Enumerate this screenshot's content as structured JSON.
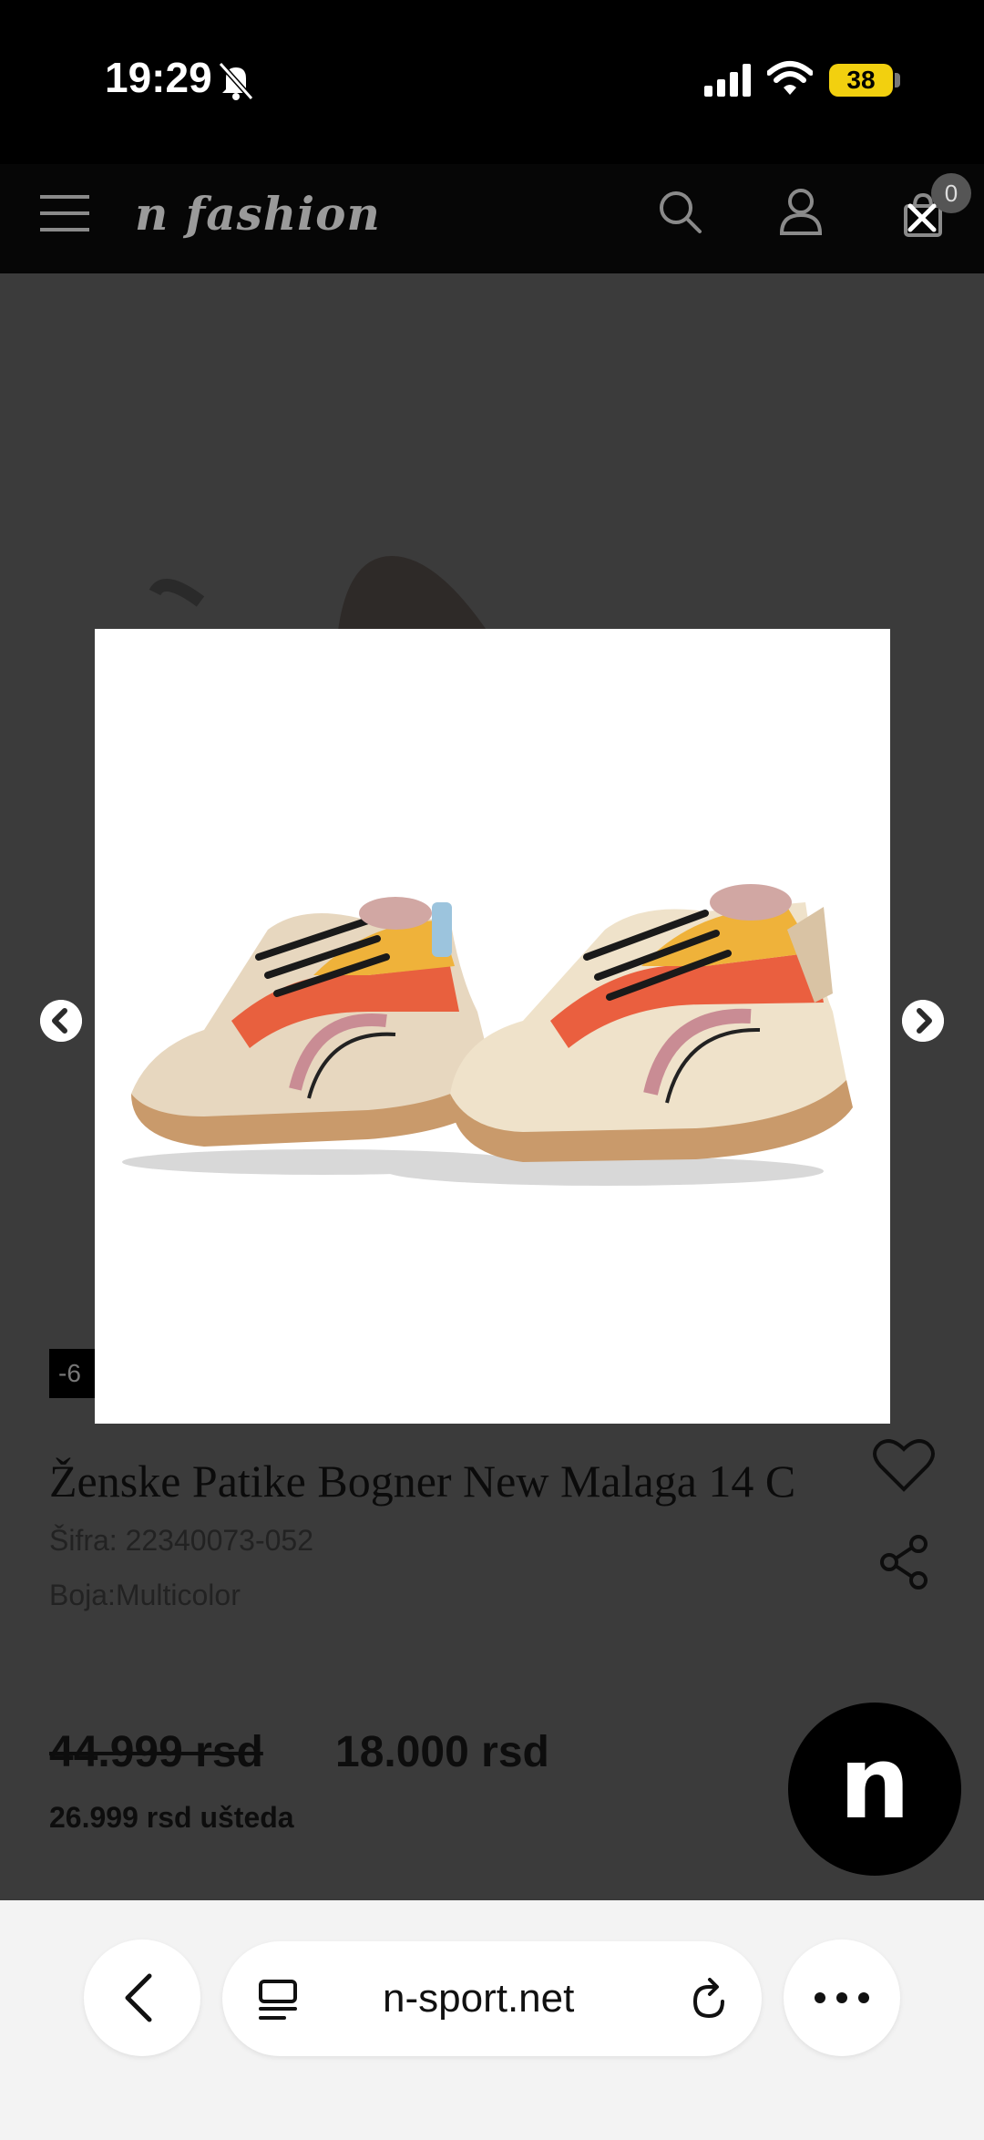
{
  "status_bar": {
    "time": "19:29",
    "battery": "38"
  },
  "header": {
    "logo": "n fashion",
    "cart_count": "0"
  },
  "product": {
    "discount_badge": "-6",
    "title": "Ženske Patike Bogner New Malaga 14 C",
    "sku": "Šifra: 22340073-052",
    "color": "Boja:Multicolor",
    "old_price": "44.999 rsd",
    "new_price": "18.000 rsd",
    "saving": "26.999 rsd ušteda"
  },
  "brand_fab": {
    "letter": "n"
  },
  "browser": {
    "url": "n-sport.net"
  },
  "icons": [
    "bell-slash-icon",
    "signal-icon",
    "wifi-icon",
    "battery-icon",
    "menu-icon",
    "search-icon",
    "user-icon",
    "cart-icon",
    "close-icon",
    "chevron-left-icon",
    "chevron-right-icon",
    "heart-icon",
    "share-icon",
    "back-icon",
    "tabs-icon",
    "reload-icon",
    "more-icon"
  ]
}
